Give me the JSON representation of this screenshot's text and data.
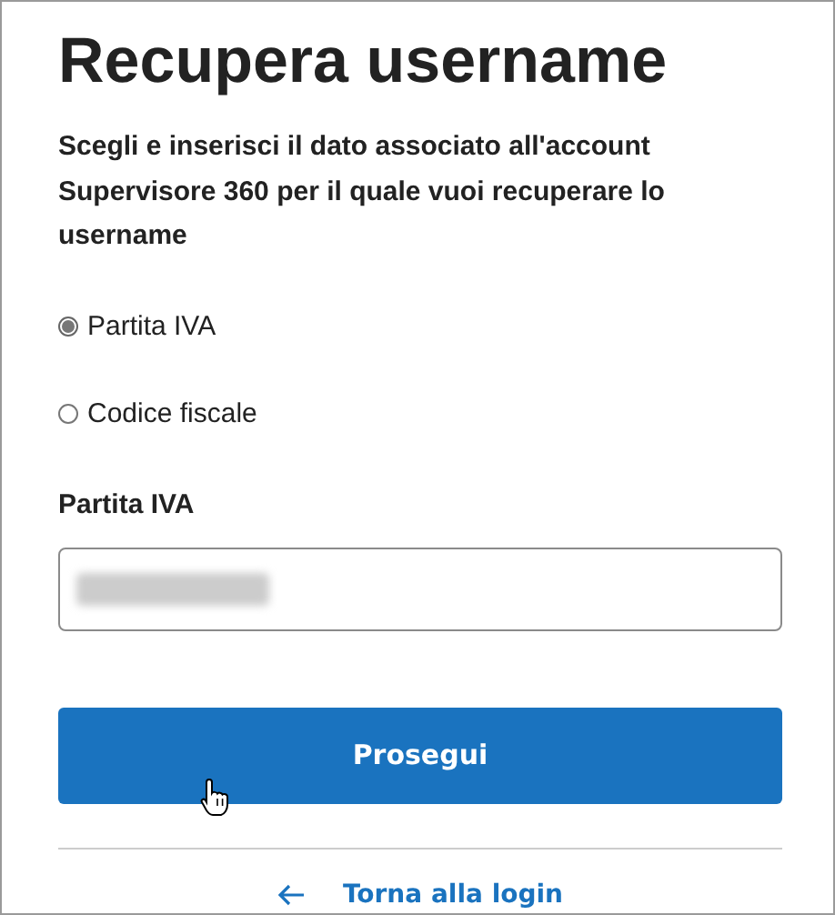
{
  "title": "Recupera username",
  "description": "Scegli e inserisci il dato associato all'account Supervisore 360 per il quale vuoi recuperare lo username",
  "options": [
    {
      "label": "Partita IVA",
      "selected": true
    },
    {
      "label": "Codice fiscale",
      "selected": false
    }
  ],
  "field": {
    "label": "Partita IVA"
  },
  "button": {
    "label": "Prosegui"
  },
  "back_link": {
    "label": "Torna alla login"
  }
}
